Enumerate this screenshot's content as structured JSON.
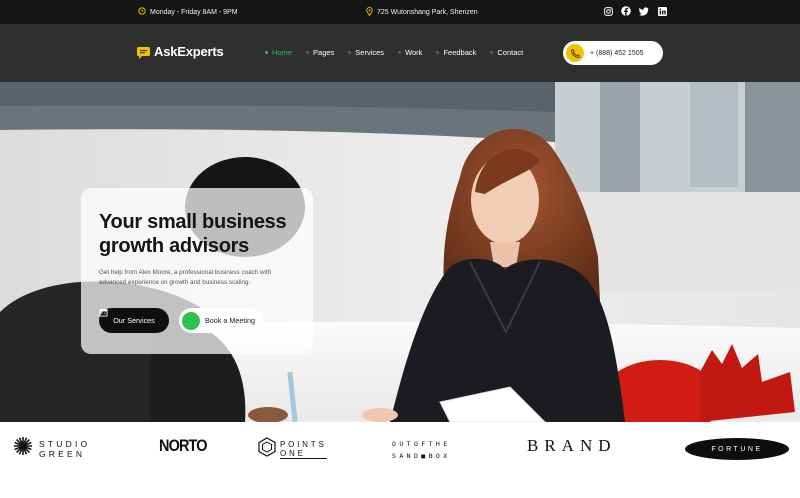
{
  "topbar": {
    "hours": "Monday - Friday 8AM - 9PM",
    "address": "725 Wutonshang Park, Shenzen",
    "socials": [
      "instagram-icon",
      "facebook-icon",
      "twitter-icon",
      "linkedin-icon"
    ]
  },
  "header": {
    "brand": "AskExperts",
    "nav": [
      {
        "label": "Home",
        "active": true
      },
      {
        "label": "Pages",
        "active": false
      },
      {
        "label": "Services",
        "active": false
      },
      {
        "label": "Work",
        "active": false
      },
      {
        "label": "Feedback",
        "active": false
      },
      {
        "label": "Contact",
        "active": false
      }
    ],
    "phone": "+ (888) 452 1505"
  },
  "hero": {
    "title": "Your small business growth advisors",
    "subtitle": "Get help from Alex Moore, a professional business coach with advanced experience on growth and business scaling.",
    "primary_button": "Our Services",
    "secondary_button": "Book a Meeting"
  },
  "brands": {
    "studio_green": {
      "line1": "STUDIO",
      "line2": "GREEN"
    },
    "norto": "NORTO",
    "points_one": {
      "line1": "POINTS",
      "line2": "ONE"
    },
    "sandbox": {
      "line1": "OUTOFTHE",
      "line2": "SAND■BOX"
    },
    "brand": "BRAND",
    "fortune": "FORTUNE"
  },
  "colors": {
    "accent": "#2fbf4f",
    "phone_icon": "#f2c200",
    "header_bg": "#2f2f2f",
    "topbar_bg": "#151515"
  }
}
